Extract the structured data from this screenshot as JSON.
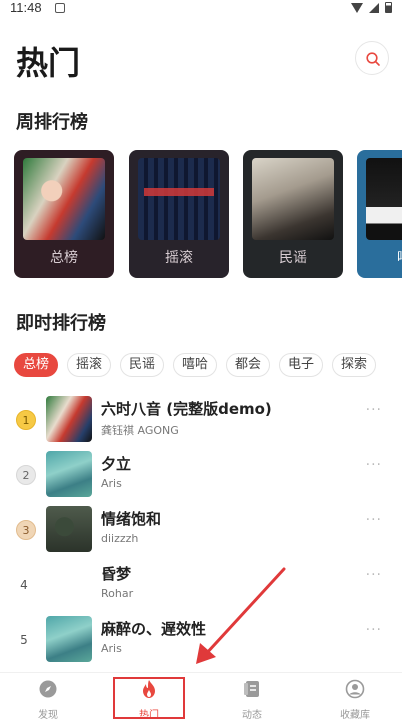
{
  "status": {
    "time": "11:48"
  },
  "header": {
    "title": "热门"
  },
  "weekly": {
    "title": "周排行榜",
    "cards": [
      {
        "label": "总榜"
      },
      {
        "label": "摇滚"
      },
      {
        "label": "民谣"
      },
      {
        "label": "嘻"
      }
    ]
  },
  "instant": {
    "title": "即时排行榜",
    "chips": [
      "总榜",
      "摇滚",
      "民谣",
      "嘻哈",
      "都会",
      "电子",
      "探索"
    ],
    "active_chip": "总榜",
    "songs": [
      {
        "rank": "1",
        "name": "六时八音 (完整版demo)",
        "artist": "龚钰祺 AGONG"
      },
      {
        "rank": "2",
        "name": "夕立",
        "artist": "Aris"
      },
      {
        "rank": "3",
        "name": "情绪饱和",
        "artist": "diizzzh"
      },
      {
        "rank": "4",
        "name": "昏梦",
        "artist": "Rohar"
      },
      {
        "rank": "5",
        "name": "麻醉の、遅效性",
        "artist": "Aris"
      }
    ]
  },
  "tabbar": {
    "tabs": [
      {
        "label": "发现",
        "icon": "compass-icon"
      },
      {
        "label": "热门",
        "icon": "fire-icon"
      },
      {
        "label": "动态",
        "icon": "feed-icon"
      },
      {
        "label": "收藏库",
        "icon": "library-icon"
      }
    ],
    "active": "热门"
  },
  "colors": {
    "accent": "#e8483f",
    "annotation": "#e0393a"
  }
}
